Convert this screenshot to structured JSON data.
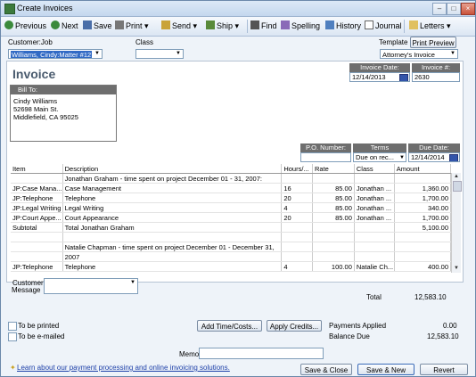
{
  "window": {
    "title": "Create Invoices"
  },
  "toolbar": {
    "previous": "Previous",
    "next": "Next",
    "save": "Save",
    "print": "Print",
    "send": "Send",
    "ship": "Ship",
    "find": "Find",
    "spelling": "Spelling",
    "history": "History",
    "journal": "Journal",
    "letters": "Letters"
  },
  "header": {
    "customer_job_label": "Customer:Job",
    "customer_job_value": "Williams, Cindy:Matter #12",
    "class_label": "Class",
    "class_value": "",
    "template_label": "Template",
    "print_preview": "Print Preview",
    "template_value": "Attorney's Invoice"
  },
  "invoice": {
    "title": "Invoice",
    "date_label": "Invoice Date:",
    "date_value": "12/14/2013",
    "number_label": "Invoice #:",
    "number_value": "2630",
    "bill_to_label": "Bill To:",
    "bill_to_lines": [
      "Cindy Williams",
      "52698 Main St.",
      "Middlefield,  CA 95025"
    ],
    "po_label": "P.O. Number:",
    "po_value": "",
    "terms_label": "Terms",
    "terms_value": "Due on rec...",
    "due_label": "Due Date:",
    "due_value": "12/14/2014"
  },
  "table": {
    "columns": [
      "Item",
      "Description",
      "Hours/...",
      "Rate",
      "Class",
      "Amount"
    ],
    "rows": [
      {
        "item": "",
        "description": "Jonathan Graham - time spent on project December 01 - 31, 2007:",
        "hours": "",
        "rate": "",
        "class": "",
        "amount": ""
      },
      {
        "item": "JP:Case Mana...",
        "description": "Case Management",
        "hours": "16",
        "rate": "85.00",
        "class": "Jonathan ...",
        "amount": "1,360.00"
      },
      {
        "item": "JP:Telephone",
        "description": "Telephone",
        "hours": "20",
        "rate": "85.00",
        "class": "Jonathan ...",
        "amount": "1,700.00"
      },
      {
        "item": "JP:Legal Writing",
        "description": "Legal Writing",
        "hours": "4",
        "rate": "85.00",
        "class": "Jonathan ...",
        "amount": "340.00"
      },
      {
        "item": "JP:Court Appe...",
        "description": "Court Appearance",
        "hours": "20",
        "rate": "85.00",
        "class": "Jonathan ...",
        "amount": "1,700.00"
      },
      {
        "item": "Subtotal",
        "description": "Total Jonathan Graham",
        "hours": "",
        "rate": "",
        "class": "",
        "amount": "5,100.00"
      },
      {
        "item": "",
        "description": "",
        "hours": "",
        "rate": "",
        "class": "",
        "amount": ""
      },
      {
        "item": "",
        "description": "Natalie Chapman - time spent on project December 01 - December 31,",
        "hours": "",
        "rate": "",
        "class": "",
        "amount": ""
      },
      {
        "item": "",
        "description": "2007",
        "hours": "",
        "rate": "",
        "class": "",
        "amount": ""
      },
      {
        "item": "JP:Telephone",
        "description": "Telephone",
        "hours": "4",
        "rate": "100.00",
        "class": "Natalie Ch...",
        "amount": "400.00"
      }
    ]
  },
  "footer": {
    "customer_message_label_1": "Customer",
    "customer_message_label_2": "Message",
    "total_label": "Total",
    "total_value": "12,583.10",
    "to_be_printed": "To be printed",
    "to_be_emailed": "To be e-mailed",
    "add_time_costs": "Add Time/Costs...",
    "apply_credits": "Apply Credits...",
    "payments_applied_label": "Payments Applied",
    "payments_applied_value": "0.00",
    "balance_due_label": "Balance Due",
    "balance_due_value": "12,583.10",
    "memo_label": "Memo",
    "learn_link": "Learn about our payment processing and online invoicing solutions.",
    "save_close": "Save & Close",
    "save_new": "Save & New",
    "revert": "Revert"
  },
  "colors": {
    "accent": "#316ac5",
    "header_bar": "#6e6e6e",
    "window_bg": "#eef3f9"
  }
}
